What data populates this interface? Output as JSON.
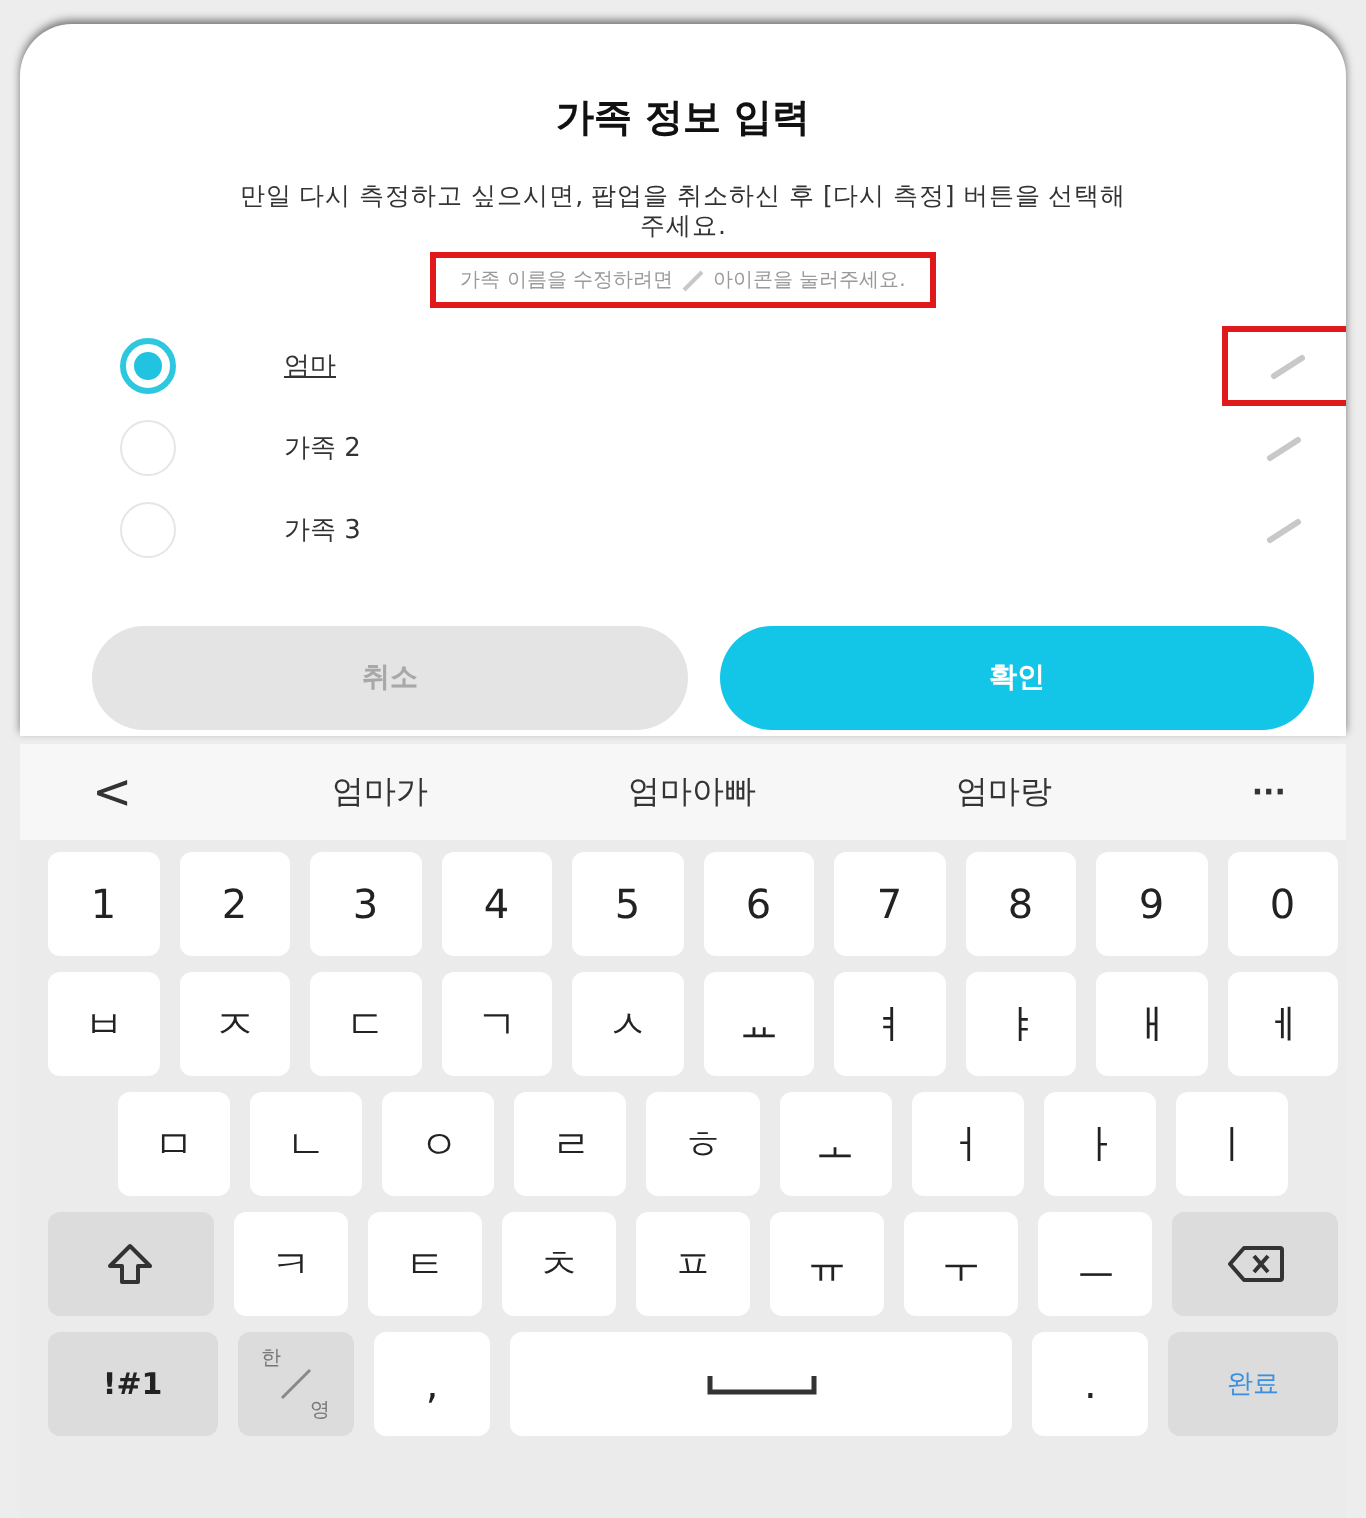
{
  "dialog": {
    "title": "가족 정보 입력",
    "message": "만일 다시 측정하고 싶으시면, 팝업을 취소하신 후 [다시 측정] 버튼을 선택해 주세요.",
    "hint_before": "가족 이름을 수정하려면",
    "hint_after": "아이콘을 눌러주세요.",
    "hint_highlighted": true,
    "members": [
      {
        "name": "엄마",
        "selected": true,
        "editing": true,
        "highlighted": true
      },
      {
        "name": "가족 2",
        "selected": false,
        "editing": false,
        "highlighted": false
      },
      {
        "name": "가족 3",
        "selected": false,
        "editing": false,
        "highlighted": false
      }
    ],
    "buttons": [
      {
        "label": "취소",
        "kind": "cancel"
      },
      {
        "label": "확인",
        "kind": "confirm"
      }
    ]
  },
  "keyboard": {
    "back": "<",
    "suggestions": [
      "엄마가",
      "엄마아빠",
      "엄마랑"
    ],
    "more": "···",
    "rows": [
      [
        {
          "kind": "char",
          "label": "1"
        },
        {
          "kind": "char",
          "label": "2"
        },
        {
          "kind": "char",
          "label": "3"
        },
        {
          "kind": "char",
          "label": "4"
        },
        {
          "kind": "char",
          "label": "5"
        },
        {
          "kind": "char",
          "label": "6"
        },
        {
          "kind": "char",
          "label": "7"
        },
        {
          "kind": "char",
          "label": "8"
        },
        {
          "kind": "char",
          "label": "9"
        },
        {
          "kind": "char",
          "label": "0"
        }
      ],
      [
        {
          "kind": "char",
          "label": "ㅂ"
        },
        {
          "kind": "char",
          "label": "ㅈ"
        },
        {
          "kind": "char",
          "label": "ㄷ"
        },
        {
          "kind": "char",
          "label": "ㄱ"
        },
        {
          "kind": "char",
          "label": "ㅅ"
        },
        {
          "kind": "char",
          "label": "ㅛ"
        },
        {
          "kind": "char",
          "label": "ㅕ"
        },
        {
          "kind": "char",
          "label": "ㅑ"
        },
        {
          "kind": "char",
          "label": "ㅐ"
        },
        {
          "kind": "char",
          "label": "ㅔ"
        }
      ],
      [
        {
          "kind": "char",
          "label": "ㅁ"
        },
        {
          "kind": "char",
          "label": "ㄴ"
        },
        {
          "kind": "char",
          "label": "ㅇ"
        },
        {
          "kind": "char",
          "label": "ㄹ"
        },
        {
          "kind": "char",
          "label": "ㅎ"
        },
        {
          "kind": "char",
          "label": "ㅗ"
        },
        {
          "kind": "char",
          "label": "ㅓ"
        },
        {
          "kind": "char",
          "label": "ㅏ"
        },
        {
          "kind": "char",
          "label": "ㅣ"
        }
      ],
      [
        {
          "kind": "shift"
        },
        {
          "kind": "char",
          "label": "ㅋ"
        },
        {
          "kind": "char",
          "label": "ㅌ"
        },
        {
          "kind": "char",
          "label": "ㅊ"
        },
        {
          "kind": "char",
          "label": "ㅍ"
        },
        {
          "kind": "char",
          "label": "ㅠ"
        },
        {
          "kind": "char",
          "label": "ㅜ"
        },
        {
          "kind": "char",
          "label": "ㅡ"
        },
        {
          "kind": "backspace"
        }
      ],
      [
        {
          "kind": "symbol",
          "label": "!#1"
        },
        {
          "kind": "lang",
          "top": "한",
          "bottom": "영"
        },
        {
          "kind": "char",
          "label": ","
        },
        {
          "kind": "space"
        },
        {
          "kind": "char",
          "label": "."
        },
        {
          "kind": "done",
          "label": "완료"
        }
      ]
    ]
  }
}
